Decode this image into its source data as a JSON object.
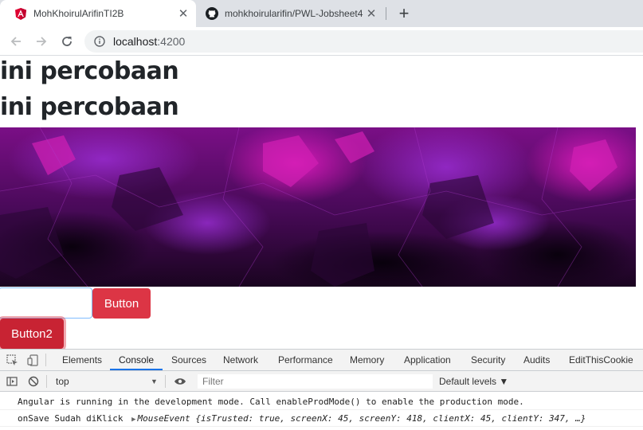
{
  "browser": {
    "tabs": [
      {
        "title": "MohKhoirulArifinTI2B",
        "active": true
      },
      {
        "title": "mohkhoirularifin/PWL-Jobsheet4",
        "active": false
      }
    ],
    "address": {
      "host": "localhost",
      "port": ":4200"
    }
  },
  "page": {
    "headings": [
      "ini percobaan",
      "ini percobaan"
    ],
    "button_label": "Button",
    "button2_label": "Button2"
  },
  "devtools": {
    "tabs": [
      "Elements",
      "Console",
      "Sources",
      "Network",
      "Performance",
      "Memory",
      "Application",
      "Security",
      "Audits",
      "EditThisCookie"
    ],
    "active_tab": "Console",
    "context": "top",
    "filter_placeholder": "Filter",
    "levels": "Default levels ▼",
    "console": {
      "line1": "Angular is running in the development mode. Call enableProdMode() to enable the production mode.",
      "line2_prefix": "onSave Sudah diKlick",
      "line2_object": "MouseEvent {isTrusted: true, screenX: 45, screenY: 418, clientX: 45, clientY: 347, …}"
    }
  },
  "colors": {
    "accent": "#1a73e8",
    "danger": "#dc3545",
    "banner_magenta": "#c2149e"
  }
}
